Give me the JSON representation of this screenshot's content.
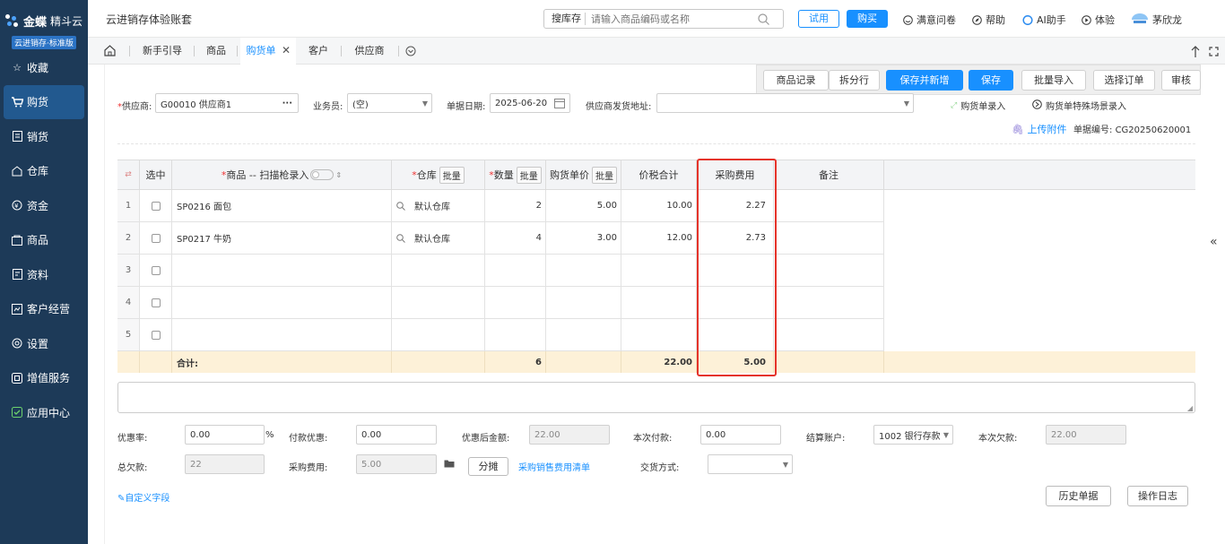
{
  "sidebar": {
    "logo_brand": "金蝶",
    "logo_product": "精斗云",
    "logo_edition": "云进销存·标准版",
    "items": [
      {
        "label": "收藏",
        "icon": "star-icon"
      },
      {
        "label": "购货",
        "icon": "cart-icon"
      },
      {
        "label": "销货",
        "icon": "sales-icon"
      },
      {
        "label": "仓库",
        "icon": "warehouse-icon"
      },
      {
        "label": "资金",
        "icon": "money-icon"
      },
      {
        "label": "商品",
        "icon": "goods-icon"
      },
      {
        "label": "资料",
        "icon": "document-icon"
      },
      {
        "label": "客户经营",
        "icon": "customer-icon"
      },
      {
        "label": "设置",
        "icon": "settings-icon"
      },
      {
        "label": "增值服务",
        "icon": "value-added-icon"
      },
      {
        "label": "应用中心",
        "icon": "app-center-icon"
      }
    ]
  },
  "topbar": {
    "title": "云进销存体验账套",
    "search_type": "搜库存",
    "search_placeholder": "请输入商品编码或名称",
    "trial": "试用",
    "buy": "购买",
    "survey": "满意问卷",
    "help": "帮助",
    "ai": "AI助手",
    "experience": "体验",
    "user": "茅欣龙"
  },
  "tabs": [
    {
      "label": "新手引导"
    },
    {
      "label": "商品"
    },
    {
      "label": "购货单"
    },
    {
      "label": "客户"
    },
    {
      "label": "供应商"
    }
  ],
  "toolbar": {
    "goods_record": "商品记录",
    "split_row": "拆分行",
    "save_new": "保存并新增",
    "save": "保存",
    "batch_import": "批量导入",
    "select_order": "选择订单",
    "audit": "审核"
  },
  "form": {
    "supplier_label": "供应商:",
    "supplier_value": "G00010 供应商1",
    "salesman_label": "业务员:",
    "salesman_value": "(空)",
    "date_label": "单据日期:",
    "date_value": "2025-06-20",
    "address_label": "供应商发货地址:",
    "purchase_entry": "购货单录入",
    "special_entry": "购货单特殊场景录入",
    "upload": "上传附件",
    "doc_no_label": "单据编号:",
    "doc_no_value": "CG20250620001"
  },
  "grid": {
    "headers": {
      "select": "选中",
      "goods": "商品 -- 扫描枪录入",
      "warehouse": "仓库",
      "qty": "数量",
      "price": "购货单价",
      "total": "价税合计",
      "fee": "采购费用",
      "remark": "备注"
    },
    "batch": "批量",
    "rows": [
      {
        "no": "1",
        "goods": "SP0216 面包",
        "warehouse": "默认仓库",
        "qty": "2",
        "price": "5.00",
        "total": "10.00",
        "fee": "2.27"
      },
      {
        "no": "2",
        "goods": "SP0217 牛奶",
        "warehouse": "默认仓库",
        "qty": "4",
        "price": "3.00",
        "total": "12.00",
        "fee": "2.73"
      },
      {
        "no": "3"
      },
      {
        "no": "4"
      },
      {
        "no": "5"
      }
    ],
    "sum_label": "合计:",
    "sum_qty": "6",
    "sum_total": "22.00",
    "sum_fee": "5.00"
  },
  "bottom": {
    "discount_rate_label": "优惠率:",
    "discount_rate": "0.00",
    "pct": "%",
    "pay_discount_label": "付款优惠:",
    "pay_discount": "0.00",
    "after_discount_label": "优惠后金额:",
    "after_discount": "22.00",
    "this_pay_label": "本次付款:",
    "this_pay": "0.00",
    "account_label": "结算账户:",
    "account": "1002 银行存款",
    "this_debt_label": "本次欠款:",
    "this_debt": "22.00",
    "total_debt_label": "总欠款:",
    "total_debt": "22",
    "purchase_fee_label": "采购费用:",
    "purchase_fee": "5.00",
    "allocate": "分摊",
    "fee_list": "采购销售费用清单",
    "delivery_label": "交货方式:",
    "custom_field": "自定义字段",
    "history": "历史单据",
    "oplog": "操作日志"
  }
}
